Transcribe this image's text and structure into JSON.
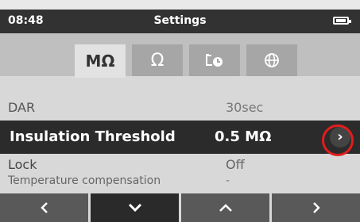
{
  "status_bar": {
    "time": "08:48",
    "title": "Settings",
    "battery_icon": "battery-full-icon"
  },
  "tabs": [
    {
      "label": "MΩ",
      "icon": "megaohm-icon",
      "active": true
    },
    {
      "label": "Ω",
      "icon": "ohm-icon",
      "active": false
    },
    {
      "label": "",
      "icon": "clock-settings-icon",
      "active": false
    },
    {
      "label": "",
      "icon": "globe-icon",
      "active": false
    }
  ],
  "settings": {
    "dar": {
      "label": "DAR",
      "value": "30sec"
    },
    "insulation_threshold": {
      "label": "Insulation Threshold",
      "value": "0.5 MΩ"
    },
    "lock": {
      "label": "Lock",
      "value": "Off"
    },
    "temperature_compensation": {
      "label": "Temperature compensation",
      "value": "-"
    }
  },
  "nav": {
    "left_icon": "chevron-left-icon",
    "down_icon": "chevron-down-icon",
    "up_icon": "chevron-up-icon",
    "right_icon": "chevron-right-icon"
  },
  "colors": {
    "highlight_row": "#2b2b2b",
    "callout": "#e21d1d",
    "status_bar": "#323232",
    "tab_active": "#e2e2e2",
    "tab_inactive": "#a6a6a6"
  }
}
